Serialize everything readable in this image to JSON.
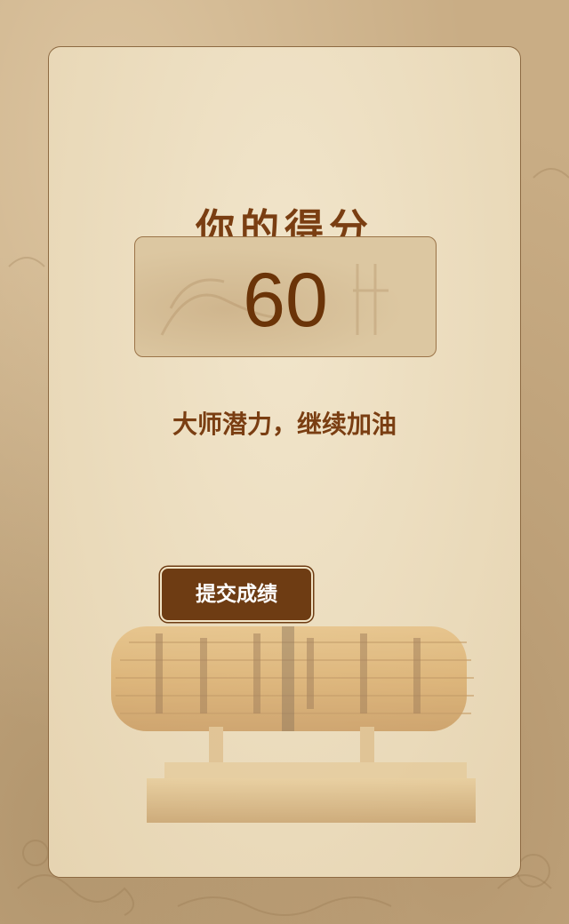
{
  "result": {
    "title": "你的得分",
    "score": "60",
    "comment": "大师潜力，继续加油",
    "submit_label": "提交成绩"
  },
  "colors": {
    "background": "#c9ad85",
    "card": "#ebdcbd",
    "accent_text": "#7a3e12",
    "button": "#6e3c13",
    "button_text": "#ffffff"
  },
  "icons": {
    "decoration": "bamboo-scroll-illustration"
  }
}
